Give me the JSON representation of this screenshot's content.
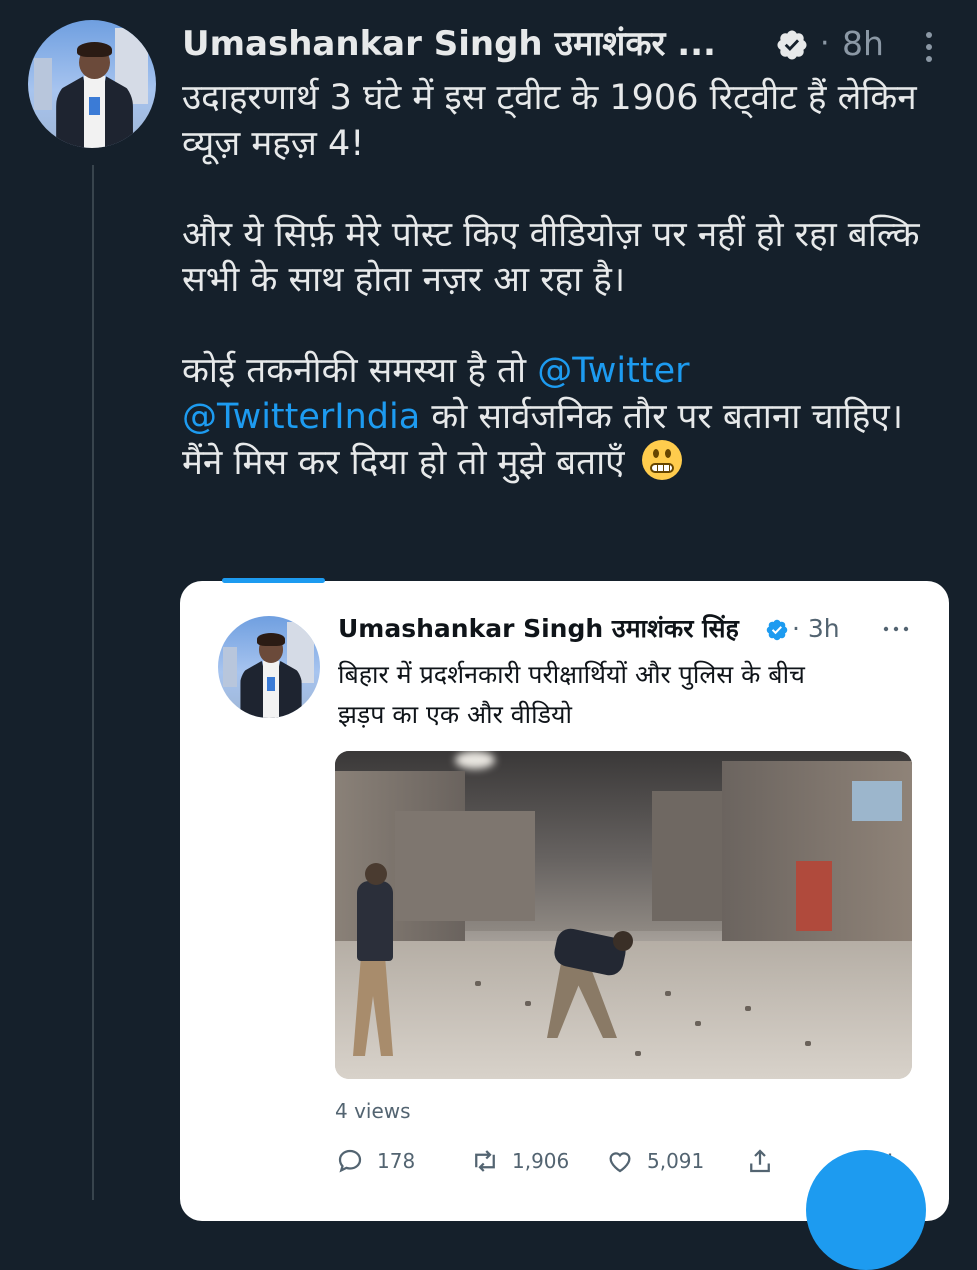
{
  "tweet": {
    "author": "Umashankar Singh उमाशंकर ...",
    "separator": "·",
    "time": "8h",
    "paragraphs": [
      "उदाहरणार्थ 3 घंटे में इस ट्वीट के 1906 रिट्वीट हैं लेकिन व्यूज़ महज़ 4!",
      "और ये सिर्फ़ मेरे पोस्ट किए वीडियोज़ पर नहीं हो रहा बल्कि सभी के साथ होता नज़र आ रहा है।"
    ],
    "p3_before": "कोई तकनीकी समस्या है तो ",
    "mention1": "@Twitter",
    "mention2": "@TwitterIndia",
    "p3_after": " को सार्वजनिक तौर पर बताना चाहिए। मैंने मिस कर दिया हो तो मुझे बताएँ "
  },
  "quoted": {
    "author": "Umashankar Singh उमाशंकर सिंह",
    "time": "3h",
    "text_line1": "बिहार में प्रदर्शनकारी परीक्षार्थियों और पुलिस के बीच",
    "text_line2": "झड़प का एक और वीडियो",
    "views": "4 views",
    "replies": "178",
    "retweets": "1,906",
    "likes": "5,091"
  },
  "colors": {
    "background": "#15202b",
    "accent": "#1d9bf0",
    "text": "#e7e9ea",
    "muted": "#8b98a5"
  },
  "icons": [
    "verified-badge-icon",
    "more-icon",
    "reply-icon",
    "retweet-icon",
    "like-icon",
    "share-icon",
    "grimacing-emoji"
  ]
}
